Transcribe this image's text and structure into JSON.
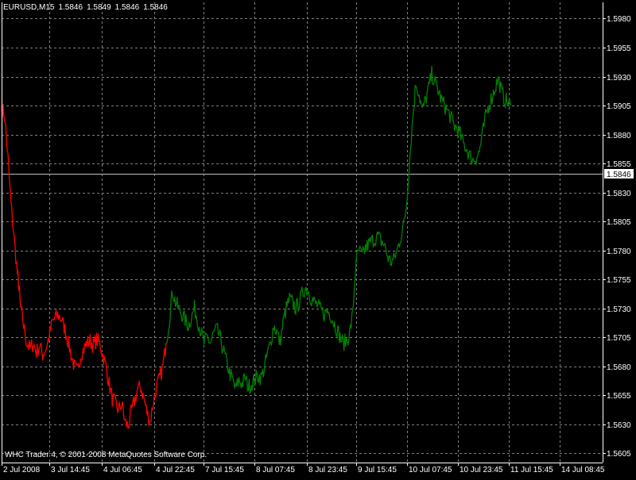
{
  "header": {
    "symbol": "EURUSD,M15",
    "open": "1.5846",
    "high": "1.5849",
    "low": "1.5846",
    "close": "1.5846"
  },
  "copyright": "WHC Trader 4, © 2001-2008 MetaQuotes Software Corp.",
  "colors": {
    "background": "#000000",
    "grid": "#7f7f7f",
    "down_series": "#ff0000",
    "up_series": "#008000",
    "current_price_line": "#c0c0c0",
    "axis_text": "#ffffff",
    "price_label_bg": "#ffffff",
    "price_label_text": "#000000"
  },
  "chart_data": {
    "type": "line",
    "title": "EURUSD,M15",
    "xlabel": "",
    "ylabel": "",
    "grid": true,
    "ylim": [
      1.5597,
      1.5994
    ],
    "y_ticks": [
      "1.5980",
      "1.5955",
      "1.5930",
      "1.5905",
      "1.5880",
      "1.5855",
      "1.5830",
      "1.5805",
      "1.5780",
      "1.5755",
      "1.5730",
      "1.5705",
      "1.5680",
      "1.5655",
      "1.5630",
      "1.5605"
    ],
    "x_ticks": [
      "2 Jul 2008",
      "3 Jul 14:45",
      "4 Jul 06:45",
      "4 Jul 22:45",
      "7 Jul 15:45",
      "8 Jul 07:45",
      "8 Jul 23:45",
      "9 Jul 15:45",
      "10 Jul 07:45",
      "10 Jul 23:45",
      "11 Jul 15:45",
      "14 Jul 08:45"
    ],
    "current_price": 1.5846,
    "current_price_label": "1.5846",
    "series": [
      {
        "color": "red",
        "x": [
          0,
          4,
          8,
          12,
          16,
          20,
          22,
          24,
          28,
          32,
          36,
          40,
          44,
          48,
          52,
          56,
          60,
          64,
          68,
          72,
          76,
          80,
          84,
          88,
          92,
          96,
          100,
          104,
          108,
          112,
          116,
          120,
          124,
          128,
          132,
          136,
          140,
          144,
          148,
          152,
          156,
          160,
          164,
          168,
          172,
          176,
          180,
          184,
          188,
          192,
          196,
          200,
          204,
          208
        ],
        "y": [
          1.5905,
          1.5895,
          1.586,
          1.582,
          1.579,
          1.576,
          1.5748,
          1.573,
          1.5715,
          1.57,
          1.5695,
          1.57,
          1.5692,
          1.5698,
          1.569,
          1.5695,
          1.5705,
          1.5718,
          1.5722,
          1.5724,
          1.572,
          1.5712,
          1.5702,
          1.569,
          1.568,
          1.5675,
          1.569,
          1.5695,
          1.57,
          1.5702,
          1.5698,
          1.5703,
          1.57,
          1.569,
          1.568,
          1.5665,
          1.5652,
          1.5648,
          1.5642,
          1.5648,
          1.5632,
          1.5628,
          1.564,
          1.565,
          1.566,
          1.5662,
          1.5652,
          1.564,
          1.5632,
          1.565,
          1.5662,
          1.567,
          1.568,
          1.57
        ]
      },
      {
        "color": "green",
        "x": [
          208,
          212,
          216,
          220,
          224,
          228,
          232,
          236,
          240,
          244,
          248,
          252,
          256,
          260,
          264,
          268,
          272,
          276,
          280,
          284,
          288,
          292,
          296,
          300,
          304,
          308,
          312,
          316,
          320,
          324,
          328,
          332,
          336,
          340,
          344,
          348,
          352,
          356,
          360,
          364,
          368,
          372,
          376,
          380,
          384,
          388,
          392,
          396,
          400,
          404,
          408,
          412,
          416,
          420,
          424,
          428,
          432,
          436,
          440,
          444,
          448,
          452,
          456,
          460,
          464,
          468,
          472,
          476,
          480,
          484,
          488,
          492,
          496,
          500,
          504,
          508,
          512,
          516,
          520,
          524,
          528,
          532,
          536,
          540,
          544,
          548,
          552,
          556,
          560,
          564,
          568,
          572,
          576,
          580,
          584,
          588,
          592,
          596,
          600,
          604,
          608,
          612,
          616,
          620,
          624,
          628,
          632,
          636,
          640,
          644
        ],
        "y": [
          1.57,
          1.572,
          1.5745,
          1.5735,
          1.573,
          1.5725,
          1.572,
          1.5715,
          1.5722,
          1.573,
          1.572,
          1.571,
          1.57,
          1.5705,
          1.57,
          1.5708,
          1.5712,
          1.5705,
          1.5695,
          1.5685,
          1.5675,
          1.5668,
          1.566,
          1.5668,
          1.5665,
          1.567,
          1.5662,
          1.5665,
          1.5668,
          1.5672,
          1.567,
          1.5678,
          1.569,
          1.57,
          1.5715,
          1.571,
          1.57,
          1.5718,
          1.573,
          1.5738,
          1.5735,
          1.573,
          1.5735,
          1.5742,
          1.5748,
          1.5745,
          1.5738,
          1.5735,
          1.5732,
          1.5728,
          1.5725,
          1.5728,
          1.5725,
          1.5718,
          1.5712,
          1.5705,
          1.57,
          1.5702,
          1.5708,
          1.5725,
          1.577,
          1.578,
          1.5775,
          1.5782,
          1.5785,
          1.5788,
          1.579,
          1.5792,
          1.5788,
          1.5785,
          1.5775,
          1.577,
          1.5772,
          1.578,
          1.579,
          1.58,
          1.582,
          1.586,
          1.5895,
          1.5925,
          1.5915,
          1.59,
          1.591,
          1.592,
          1.5932,
          1.5925,
          1.5918,
          1.591,
          1.5905,
          1.59,
          1.5895,
          1.5888,
          1.5885,
          1.588,
          1.5872,
          1.5868,
          1.5862,
          1.5858,
          1.586,
          1.5865,
          1.588,
          1.5895,
          1.5905,
          1.5912,
          1.592,
          1.5928,
          1.5918,
          1.591,
          1.5908,
          1.5905
        ]
      }
    ]
  }
}
